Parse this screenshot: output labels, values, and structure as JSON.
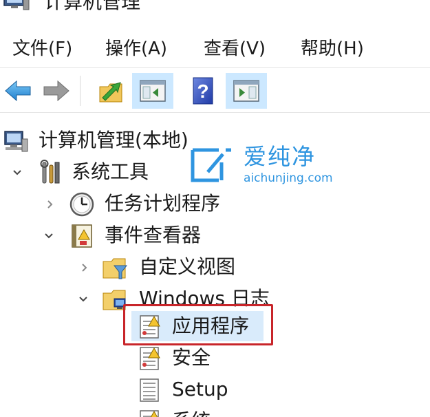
{
  "window": {
    "title": "计算机管理"
  },
  "menubar": {
    "items": [
      "文件(F)",
      "操作(A)",
      "查看(V)",
      "帮助(H)"
    ]
  },
  "toolbar": {
    "buttons": [
      {
        "icon": "back-arrow-icon",
        "active": false
      },
      {
        "icon": "forward-arrow-icon",
        "active": false
      },
      {
        "icon": "up-folder-icon",
        "active": false
      },
      {
        "icon": "show-hide-console-tree-icon",
        "active": true
      },
      {
        "icon": "help-icon",
        "active": false
      },
      {
        "icon": "show-hide-action-pane-icon",
        "active": true
      }
    ]
  },
  "tree": {
    "root": "计算机管理(本地)",
    "system_tools": "系统工具",
    "task_scheduler": "任务计划程序",
    "event_viewer": "事件查看器",
    "custom_views": "自定义视图",
    "windows_logs": "Windows 日志",
    "application": "应用程序",
    "security": "安全",
    "setup": "Setup",
    "system": "系统"
  },
  "watermark": {
    "name": "爱纯净",
    "url": "aichunjing.com"
  },
  "colors": {
    "highlight_border": "#c8252a",
    "selection": "#d9ebfb",
    "toolbar_active": "#cce8ff",
    "watermark": "#2f95e0"
  }
}
